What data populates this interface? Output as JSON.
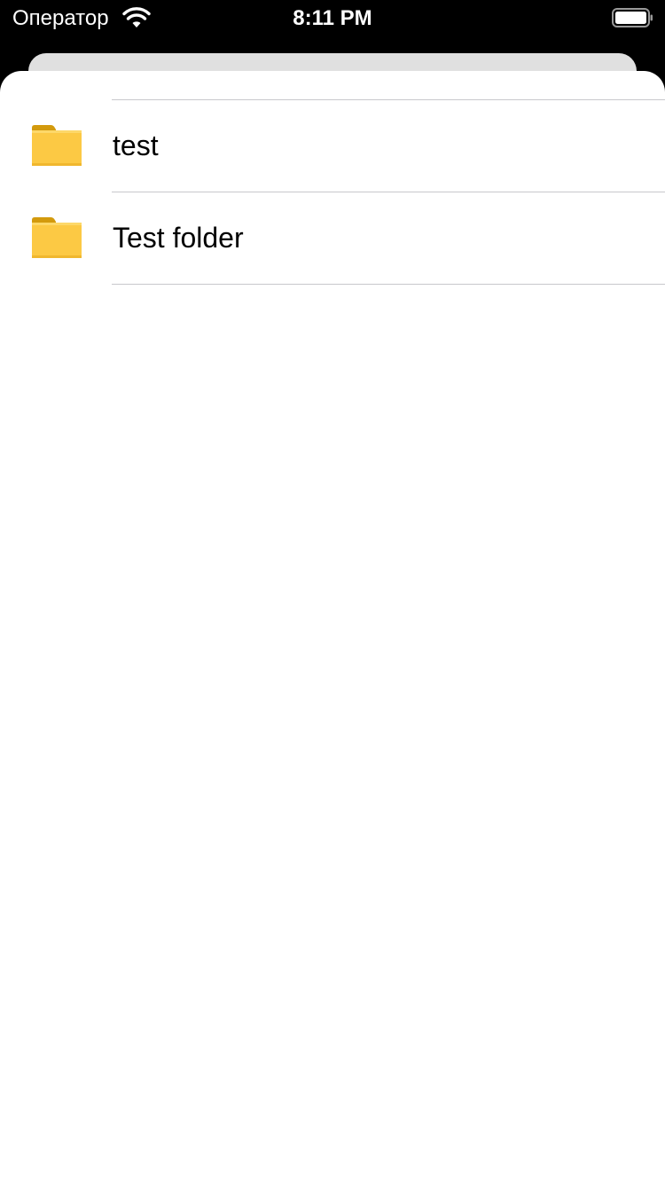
{
  "status_bar": {
    "carrier": "Оператор",
    "time": "8:11 PM",
    "wifi_icon": "wifi-icon",
    "battery_icon": "battery-icon",
    "battery_level": 1.0
  },
  "list": {
    "items": [
      {
        "label": "test",
        "icon": "folder-icon"
      },
      {
        "label": "Test folder",
        "icon": "folder-icon"
      }
    ]
  },
  "colors": {
    "background": "#000000",
    "sheet": "#ffffff",
    "back_sheet": "#e0e0e0",
    "separator": "#c8c8cc",
    "folder_body": "#fcc944",
    "folder_tab": "#d39a0d"
  }
}
